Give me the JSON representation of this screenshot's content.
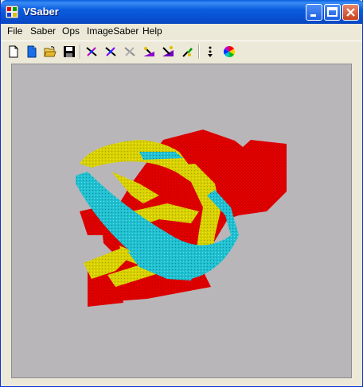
{
  "window": {
    "title": "VSaber"
  },
  "menu": {
    "items": [
      "File",
      "Saber",
      "Ops",
      "ImageSaber",
      "Help"
    ]
  },
  "toolbar": {
    "buttons": [
      {
        "icon": "new-file-icon"
      },
      {
        "icon": "new-blue-file-icon"
      },
      {
        "icon": "open-folder-icon"
      },
      {
        "icon": "save-disk-icon"
      },
      {
        "icon": "saber-tool-1-icon"
      },
      {
        "icon": "saber-tool-2-icon"
      },
      {
        "icon": "saber-tool-3-icon"
      },
      {
        "icon": "saber-tool-4-icon"
      },
      {
        "icon": "saber-tool-5-icon"
      },
      {
        "icon": "paint-brush-icon"
      },
      {
        "icon": "vertical-dots-icon"
      },
      {
        "icon": "color-wheel-icon"
      }
    ]
  },
  "viewport": {
    "background": "#b9b6b9",
    "colors": {
      "body": "#e00000",
      "ribbon1": "#d8d000",
      "ribbon2": "#20c0d0"
    }
  }
}
